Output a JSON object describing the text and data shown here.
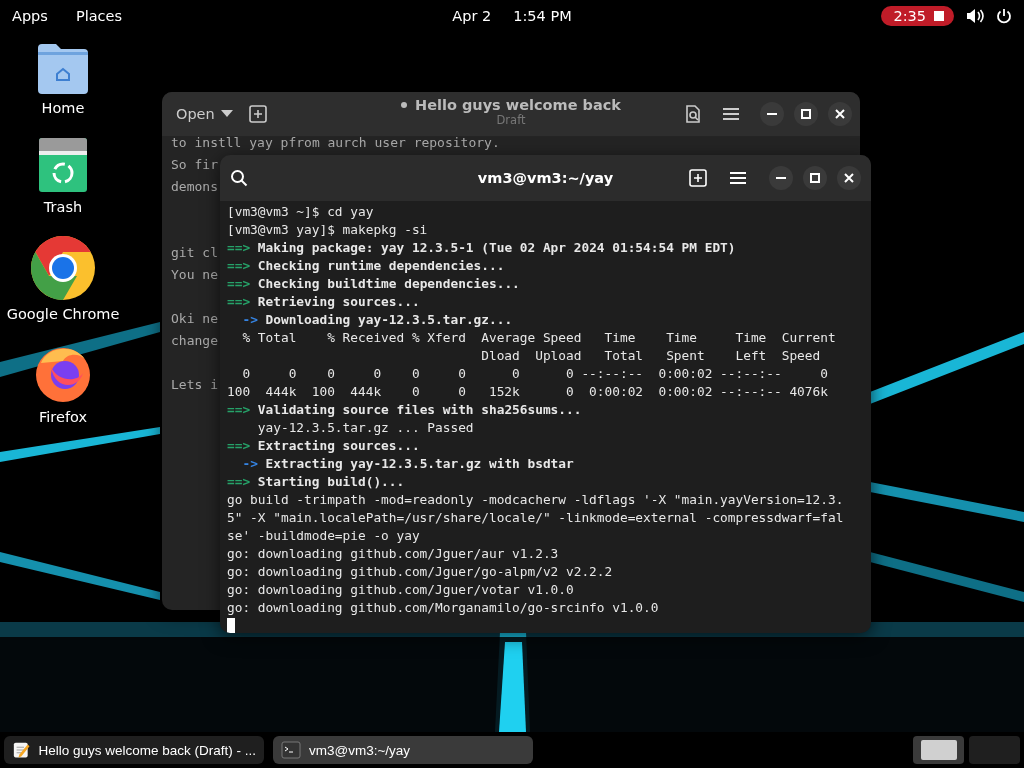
{
  "top_bar": {
    "menus": [
      "Apps",
      "Places"
    ],
    "date": "Apr 2",
    "time": "1:54 PM",
    "recording": {
      "time": "2:35"
    }
  },
  "desktop_icons": [
    {
      "label": "Home",
      "kind": "folder"
    },
    {
      "label": "Trash",
      "kind": "trash"
    },
    {
      "label": "Google Chrome",
      "kind": "chrome"
    },
    {
      "label": "Firefox",
      "kind": "firefox"
    }
  ],
  "editor": {
    "open_label": "Open",
    "title": "Hello guys welcome back",
    "modified": true,
    "subtitle": "Draft",
    "paragraphs": [
      [
        "to instll yay pfrom aurch user repository.",
        "So fir",
        "demons"
      ],
      [
        "git cl",
        "You ne"
      ],
      [
        "Oki ne",
        "change"
      ],
      [
        "Lets i"
      ]
    ]
  },
  "terminal": {
    "title": "vm3@vm3:~/yay",
    "lines": [
      {
        "kind": "plain",
        "text": "[vm3@vm3 ~]$ cd yay"
      },
      {
        "kind": "plain",
        "text": "[vm3@vm3 yay]$ makepkg -si"
      },
      {
        "kind": "step",
        "marker": "==>",
        "text": "Making package: yay 12.3.5-1 (Tue 02 Apr 2024 01:54:54 PM EDT)"
      },
      {
        "kind": "step",
        "marker": "==>",
        "text": "Checking runtime dependencies..."
      },
      {
        "kind": "step",
        "marker": "==>",
        "text": "Checking buildtime dependencies..."
      },
      {
        "kind": "step",
        "marker": "==>",
        "text": "Retrieving sources..."
      },
      {
        "kind": "substep",
        "marker": "->",
        "text": "Downloading yay-12.3.5.tar.gz..."
      },
      {
        "kind": "plain",
        "text": "  % Total    % Received % Xferd  Average Speed   Time    Time     Time  Current"
      },
      {
        "kind": "plain",
        "text": "                                 Dload  Upload   Total   Spent    Left  Speed"
      },
      {
        "kind": "plain",
        "text": "  0     0    0     0    0     0      0      0 --:--:--  0:00:02 --:--:--     0"
      },
      {
        "kind": "plain",
        "text": "100  444k  100  444k    0     0   152k      0  0:00:02  0:00:02 --:--:-- 4076k"
      },
      {
        "kind": "step",
        "marker": "==>",
        "text": "Validating source files with sha256sums..."
      },
      {
        "kind": "plain",
        "text": "    yay-12.3.5.tar.gz ... Passed"
      },
      {
        "kind": "step",
        "marker": "==>",
        "text": "Extracting sources..."
      },
      {
        "kind": "substep",
        "marker": "->",
        "text": "Extracting yay-12.3.5.tar.gz with bsdtar"
      },
      {
        "kind": "step",
        "marker": "==>",
        "text": "Starting build()..."
      },
      {
        "kind": "plain",
        "text": "go build -trimpath -mod=readonly -modcacherw -ldflags '-X \"main.yayVersion=12.3."
      },
      {
        "kind": "plain",
        "text": "5\" -X \"main.localePath=/usr/share/locale/\" -linkmode=external -compressdwarf=fal"
      },
      {
        "kind": "plain",
        "text": "se' -buildmode=pie -o yay"
      },
      {
        "kind": "plain",
        "text": "go: downloading github.com/Jguer/aur v1.2.3"
      },
      {
        "kind": "plain",
        "text": "go: downloading github.com/Jguer/go-alpm/v2 v2.2.2"
      },
      {
        "kind": "plain",
        "text": "go: downloading github.com/Jguer/votar v1.0.0"
      },
      {
        "kind": "plain",
        "text": "go: downloading github.com/Morganamilo/go-srcinfo v1.0.0"
      }
    ]
  },
  "taskbar": {
    "windows": [
      {
        "label": "Hello guys welcome back (Draft) - ...",
        "kind": "editor",
        "selected": false
      },
      {
        "label": "vm3@vm3:~/yay",
        "kind": "terminal",
        "selected": true
      }
    ],
    "workspaces": [
      {
        "selected": true
      },
      {
        "selected": false
      }
    ]
  }
}
